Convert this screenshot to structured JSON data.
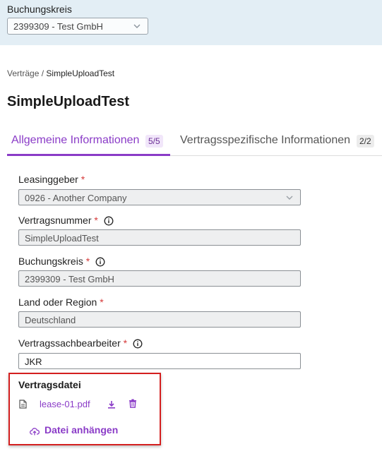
{
  "header": {
    "label": "Buchungskreis",
    "select_value": "2399309 - Test GmbH"
  },
  "breadcrumb": {
    "parent": "Verträge",
    "separator": "/",
    "current": "SimpleUploadTest"
  },
  "page_title": "SimpleUploadTest",
  "tabs": [
    {
      "label": "Allgemeine Informationen",
      "badge": "5/5",
      "active": true
    },
    {
      "label": "Vertragsspezifische Informationen",
      "badge": "2/2",
      "active": false
    }
  ],
  "form": {
    "required_marker": "*",
    "fields": [
      {
        "label": "Leasinggeber",
        "value": "0926 - Another Company",
        "type": "select",
        "info": false
      },
      {
        "label": "Vertragsnummer",
        "value": "SimpleUploadTest",
        "type": "readonly",
        "info": true
      },
      {
        "label": "Buchungskreis",
        "value": "2399309 - Test GmbH",
        "type": "readonly",
        "info": true
      },
      {
        "label": "Land oder Region",
        "value": "Deutschland",
        "type": "readonly",
        "info": false
      },
      {
        "label": "Vertragssachbearbeiter",
        "value": "JKR",
        "type": "text",
        "info": true
      }
    ]
  },
  "attachments": {
    "title": "Vertragsdatei",
    "files": [
      {
        "name": "lease-01.pdf"
      }
    ],
    "attach_label": "Datei anhängen"
  },
  "colors": {
    "accent": "#8a3bc7",
    "header_bg": "#e3eef5",
    "required": "#d63a3a",
    "highlight_border": "#d42020"
  },
  "icons": {
    "select_chevron": "chevron-down-icon",
    "field_info": "info-icon",
    "file": "file-icon",
    "download": "download-icon",
    "delete": "trash-icon",
    "attach": "cloud-upload-icon"
  }
}
